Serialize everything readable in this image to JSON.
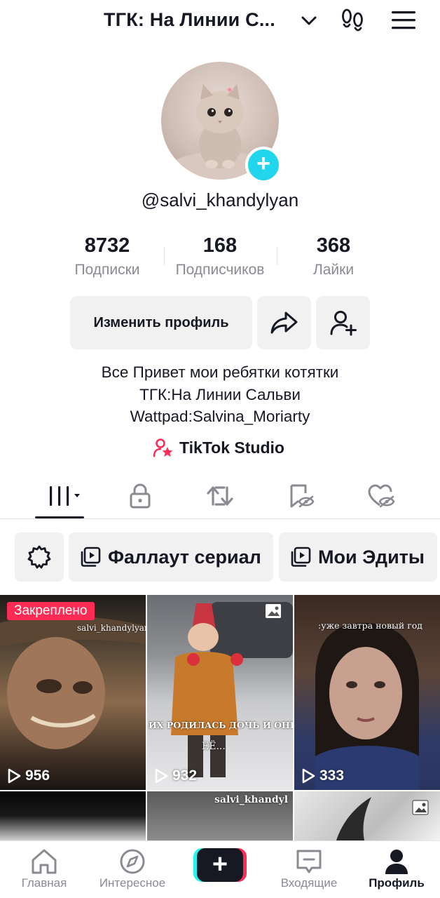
{
  "header": {
    "account_title": "ТГК: На Линии С...",
    "icons": {
      "dropdown": "chevron-down-icon",
      "footprints": "footprints-icon",
      "menu": "hamburger-menu-icon"
    }
  },
  "profile": {
    "username": "@salvi_khandylyan",
    "avatar": "kitten-photo",
    "stats": [
      {
        "value": "8732",
        "label": "Подписки"
      },
      {
        "value": "168",
        "label": "Подписчиков"
      },
      {
        "value": "368",
        "label": "Лайки"
      }
    ],
    "edit_button": "Изменить профиль",
    "bio": [
      "Все Привет мои ребятки котятки",
      "ТГК:На Линии Сальви",
      "Wattpad:Salvina_Moriarty"
    ],
    "studio_link": "TikTok Studio"
  },
  "tabs": [
    {
      "icon": "grid-videos-icon",
      "active": true
    },
    {
      "icon": "lock-icon"
    },
    {
      "icon": "repost-icon"
    },
    {
      "icon": "bookmark-hidden-icon"
    },
    {
      "icon": "heart-hidden-icon"
    }
  ],
  "playlists": {
    "chips": [
      {
        "label": "Фаллаут сериал"
      },
      {
        "label": "Мои Эдиты"
      }
    ]
  },
  "videos": [
    {
      "views": "956",
      "pinned_label": "Закреплено",
      "overlay": "salvi_khandylyan"
    },
    {
      "views": "932",
      "overlay": "ИХ РОДИЛАСЬ ДОЧЬ И ОНИ НАЗВАЛИ",
      "overlay2": "ЕЁ...",
      "photo": true
    },
    {
      "views": "333",
      "overlay": ":уже завтра новый год"
    },
    {
      "views": ""
    },
    {
      "views": "",
      "overlay": "salvi_khandyl"
    },
    {
      "views": "",
      "photo": true
    }
  ],
  "bottom_nav": [
    {
      "label": "Главная",
      "icon": "home-icon"
    },
    {
      "label": "Интересное",
      "icon": "compass-icon"
    },
    {
      "label": "",
      "icon": "create-plus-icon"
    },
    {
      "label": "Входящие",
      "icon": "inbox-icon"
    },
    {
      "label": "Профиль",
      "icon": "profile-icon",
      "active": true
    }
  ],
  "colors": {
    "accent_red": "#fe2c55",
    "accent_cyan": "#25f4ee",
    "plus_badge": "#20d5ec",
    "text": "#161823",
    "muted": "#8a8b91"
  }
}
